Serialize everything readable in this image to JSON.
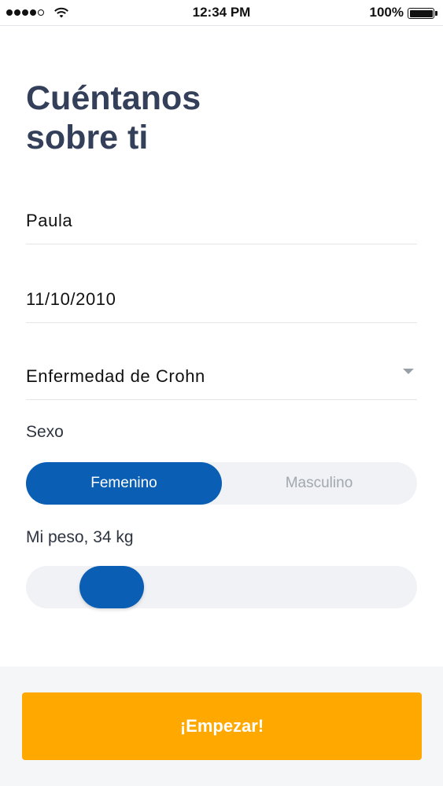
{
  "status_bar": {
    "time": "12:34 PM",
    "battery": "100%",
    "icons": [
      "signal-dots-icon",
      "wifi-icon",
      "battery-icon"
    ]
  },
  "title": "Cuéntanos\nsobre ti",
  "form": {
    "name": "Paula",
    "birthdate": "11/10/2010",
    "condition": "Enfermedad de Crohn",
    "sex_label": "Sexo",
    "sex_options": [
      "Femenino",
      "Masculino"
    ],
    "sex_selected": "Femenino",
    "weight_label": "Mi peso, 34 kg",
    "weight_value_kg": 34
  },
  "footer": {
    "start_button": "¡Empezar!"
  },
  "colors": {
    "title": "#34405a",
    "accent_blue": "#0a5fb4",
    "button_orange": "#ffa800",
    "segment_bg": "#f0f2f5"
  }
}
